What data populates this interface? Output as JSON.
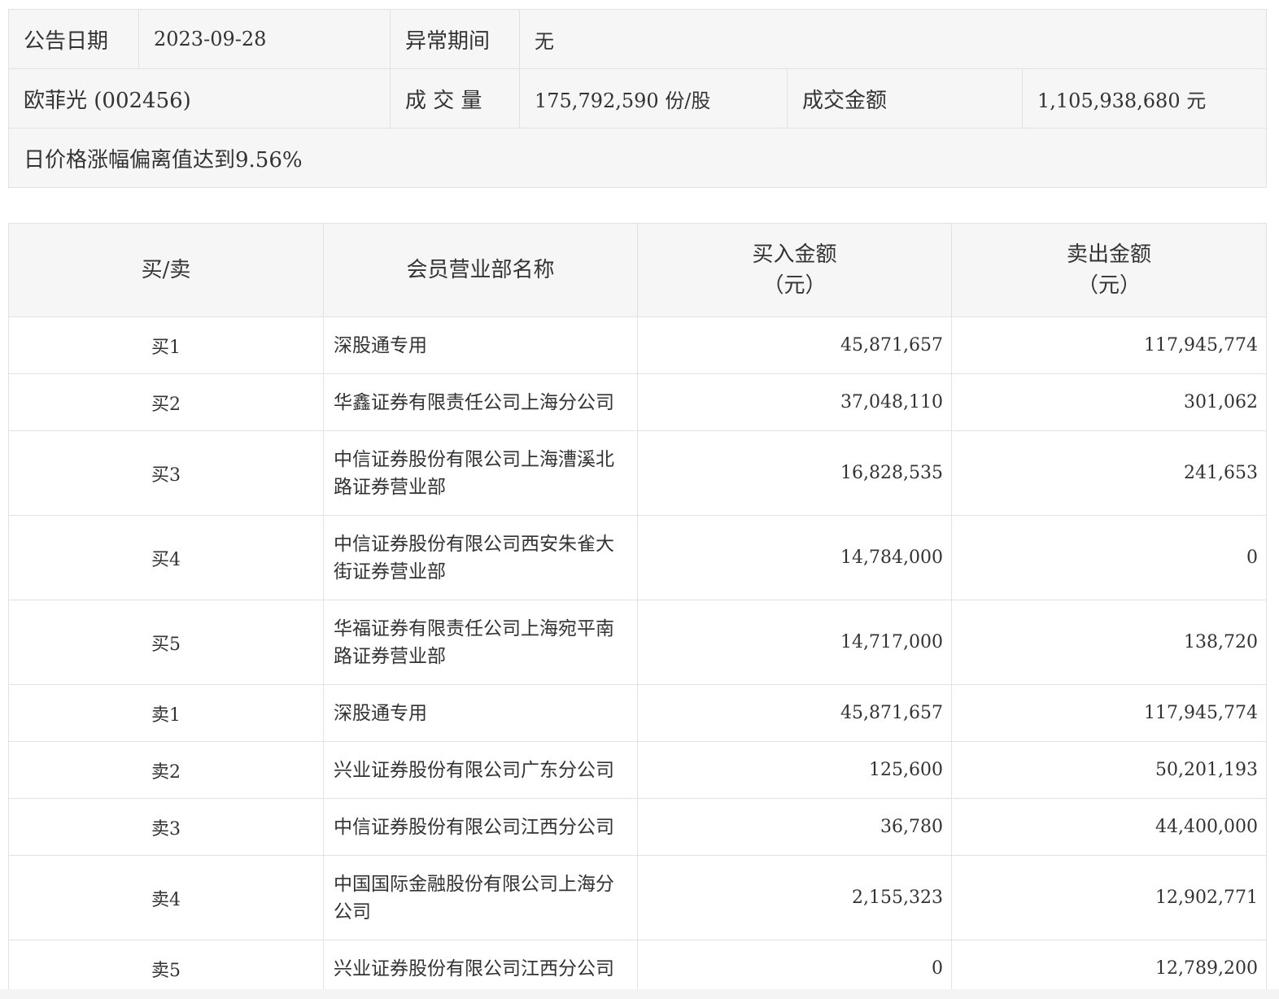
{
  "info": {
    "date_label": "公告日期",
    "date_value": "2023-09-28",
    "abnormal_label": "异常期间",
    "abnormal_value": "无",
    "stock": "欧菲光 (002456)",
    "volume_label": "成 交 量",
    "volume_value": "175,792,590 份/股",
    "amount_label": "成交金额",
    "amount_value": "1,105,938,680 元",
    "reason": "日价格涨幅偏离值达到9.56%"
  },
  "table": {
    "headers": {
      "side": "买/卖",
      "name": "会员营业部名称",
      "buy_line1": "买入金额",
      "buy_line2": "（元）",
      "sell_line1": "卖出金额",
      "sell_line2": "（元）"
    },
    "rows": [
      {
        "side": "买1",
        "name": "深股通专用",
        "buy": "45,871,657",
        "sell": "117,945,774"
      },
      {
        "side": "买2",
        "name": "华鑫证券有限责任公司上海分公司",
        "buy": "37,048,110",
        "sell": "301,062"
      },
      {
        "side": "买3",
        "name": "中信证券股份有限公司上海漕溪北路证券营业部",
        "buy": "16,828,535",
        "sell": "241,653"
      },
      {
        "side": "买4",
        "name": "中信证券股份有限公司西安朱雀大街证券营业部",
        "buy": "14,784,000",
        "sell": "0"
      },
      {
        "side": "买5",
        "name": "华福证券有限责任公司上海宛平南路证券营业部",
        "buy": "14,717,000",
        "sell": "138,720"
      },
      {
        "side": "卖1",
        "name": "深股通专用",
        "buy": "45,871,657",
        "sell": "117,945,774"
      },
      {
        "side": "卖2",
        "name": "兴业证券股份有限公司广东分公司",
        "buy": "125,600",
        "sell": "50,201,193"
      },
      {
        "side": "卖3",
        "name": "中信证券股份有限公司江西分公司",
        "buy": "36,780",
        "sell": "44,400,000"
      },
      {
        "side": "卖4",
        "name": "中国国际金融股份有限公司上海分公司",
        "buy": "2,155,323",
        "sell": "12,902,771"
      },
      {
        "side": "卖5",
        "name": "兴业证券股份有限公司江西分公司",
        "buy": "0",
        "sell": "12,789,200"
      }
    ]
  }
}
